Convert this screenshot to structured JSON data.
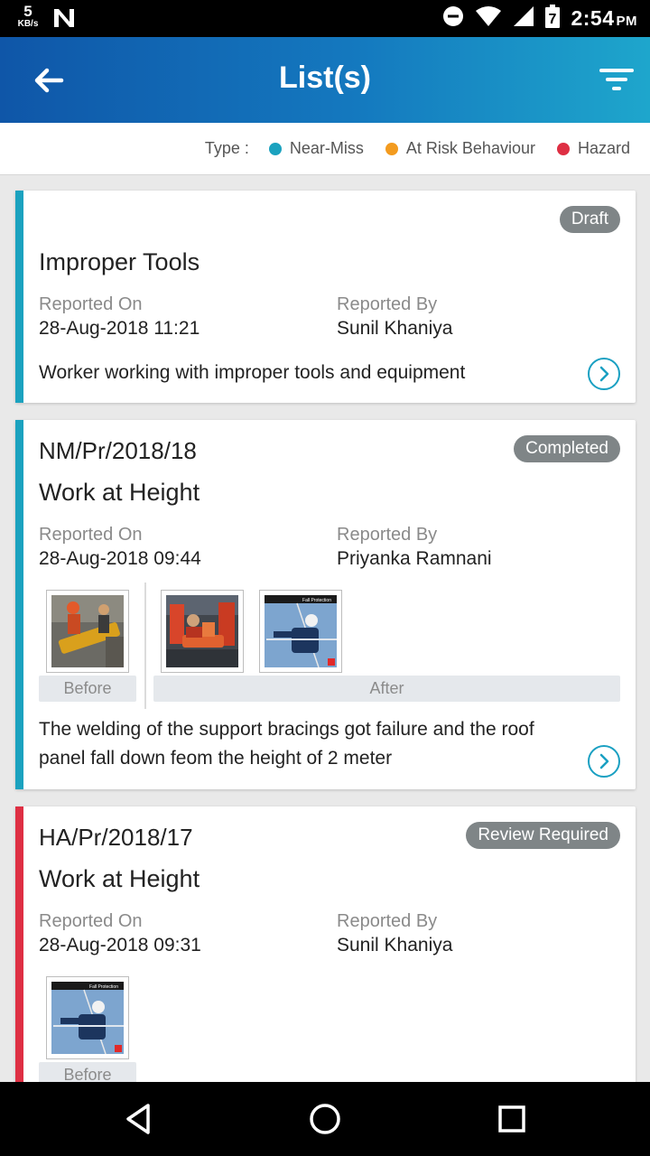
{
  "status_bar": {
    "speed_value": "5",
    "speed_unit": "KB/s",
    "time": "2:54",
    "ampm": "PM",
    "battery_level": "7",
    "icons": [
      "n-icon",
      "do-not-disturb-icon",
      "wifi-icon",
      "signal-icon",
      "battery-icon"
    ]
  },
  "app_bar": {
    "title": "List(s)"
  },
  "legend": {
    "label": "Type :",
    "items": [
      {
        "name": "Near-Miss",
        "color": "#1ba2bf"
      },
      {
        "name": "At Risk Behaviour",
        "color": "#f39b1f"
      },
      {
        "name": "Hazard",
        "color": "#de2f43"
      }
    ]
  },
  "labels": {
    "reported_on": "Reported On",
    "reported_by": "Reported By",
    "before": "Before",
    "after": "After"
  },
  "cards": [
    {
      "code": "",
      "status": "Draft",
      "title": "Improper Tools",
      "reported_on": "28-Aug-2018 11:21",
      "reported_by": "Sunil Khaniya",
      "description": "Worker working with improper tools and equipment",
      "stripe_color": "#1ba2bf"
    },
    {
      "code": "NM/Pr/2018/18",
      "status": "Completed",
      "title": "Work at Height",
      "reported_on": "28-Aug-2018 09:44",
      "reported_by": "Priyanka Ramnani",
      "description": "The welding of the support bracings got failure and the roof panel fall down feom the height of 2 meter",
      "stripe_color": "#1ba2bf",
      "photo_caption": "Fall Protection"
    },
    {
      "code": "HA/Pr/2018/17",
      "status": "Review Required",
      "title": "Work at Height",
      "reported_on": "28-Aug-2018 09:31",
      "reported_by": "Sunil Khaniya",
      "stripe_color": "#de2f43",
      "photo_caption": "Fall Protection"
    }
  ]
}
